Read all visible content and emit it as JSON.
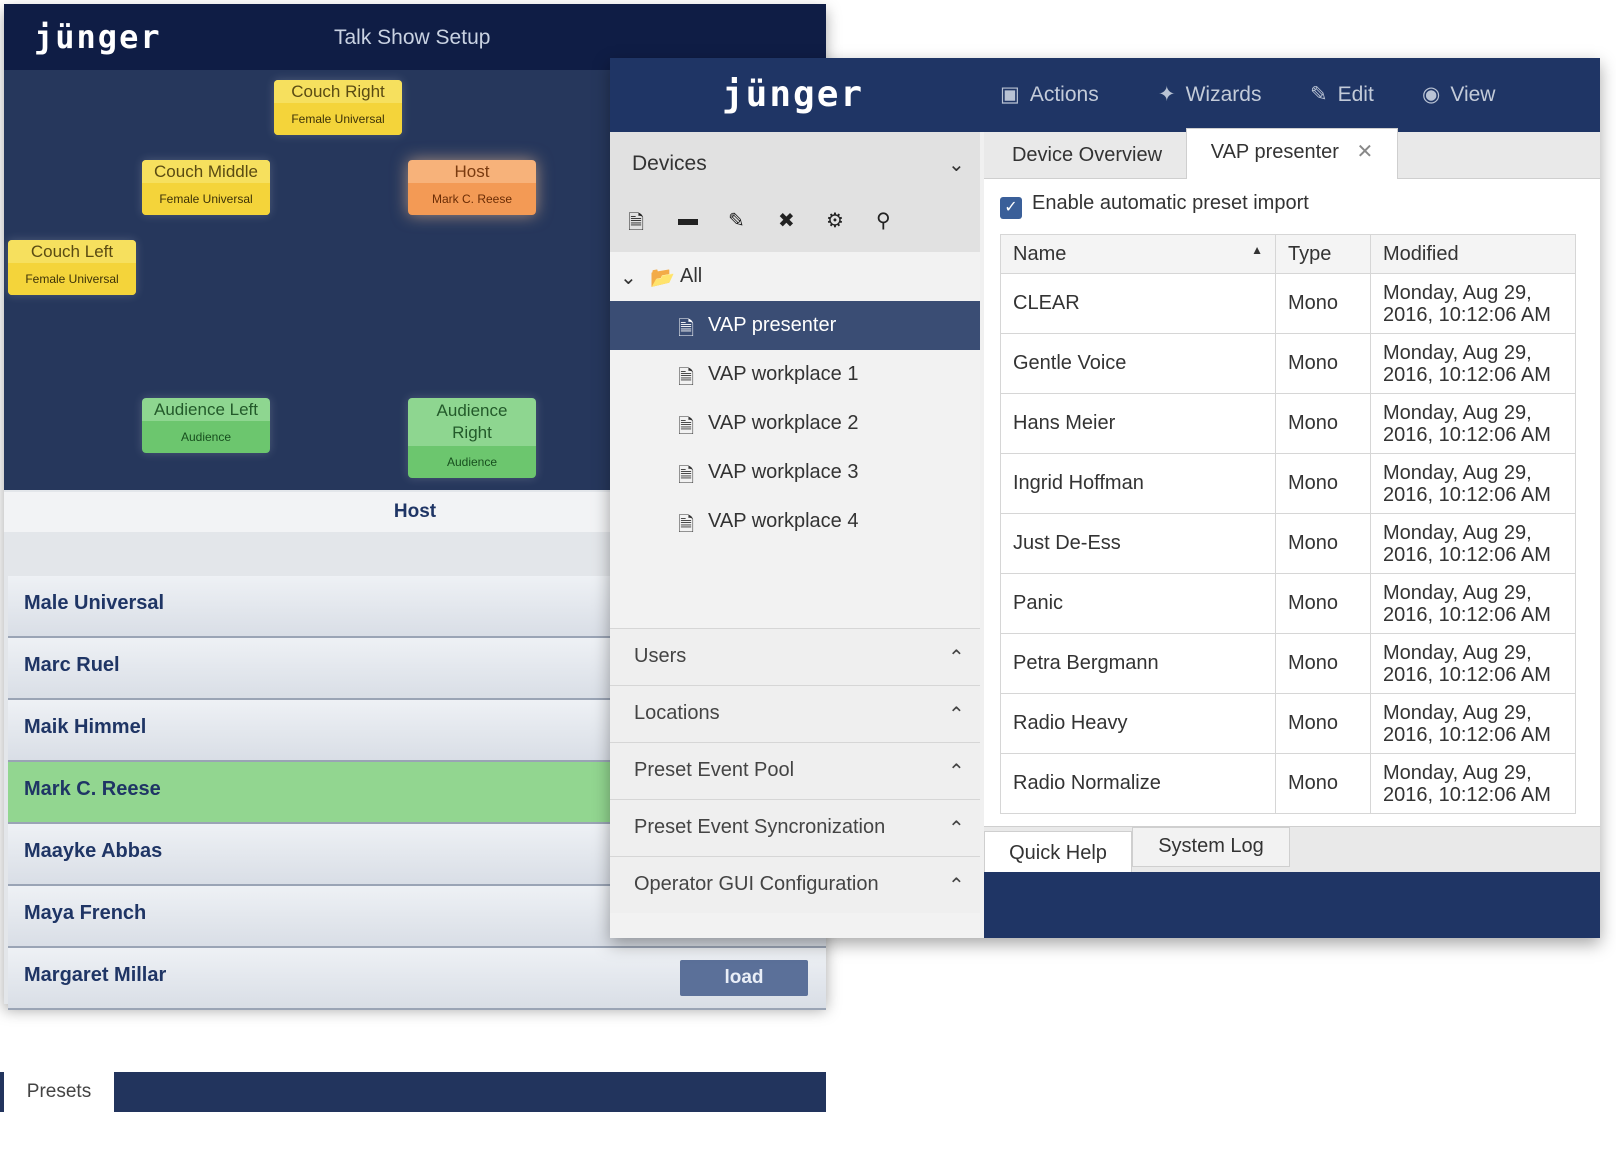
{
  "back_window": {
    "logo": "jünger",
    "title": "Talk Show Setup",
    "tiles": [
      {
        "title": "Couch Right",
        "subtitle": "Female Universal",
        "color": "yellow"
      },
      {
        "title": "Couch Middle",
        "subtitle": "Female Universal",
        "color": "yellow"
      },
      {
        "title": "Host",
        "subtitle": "Mark C. Reese",
        "color": "orange"
      },
      {
        "title": "Couch Left",
        "subtitle": "Female Universal",
        "color": "yellow"
      },
      {
        "title": "Audience Left",
        "subtitle": "Audience",
        "color": "green"
      },
      {
        "title": "Audience Right",
        "subtitle": "Audience",
        "color": "green"
      }
    ],
    "selected_label": "Host",
    "names": [
      "Male Universal",
      "Marc Ruel",
      "Maik Himmel",
      "Mark C. Reese",
      "Maayke Abbas",
      "Maya French",
      "Margaret Millar"
    ],
    "active_name": "Mark C. Reese",
    "load_label": "load",
    "presets_tab": "Presets"
  },
  "front_window": {
    "logo": "jünger",
    "menu": [
      {
        "icon": "briefcase-icon",
        "label": "Actions"
      },
      {
        "icon": "wand-icon",
        "label": "Wizards"
      },
      {
        "icon": "pencil-icon",
        "label": "Edit"
      },
      {
        "icon": "eye-icon",
        "label": "View"
      }
    ],
    "sidebar": {
      "devices_title": "Devices",
      "toolbar_icons": [
        "new-file-icon",
        "folder-icon",
        "edit-icon",
        "delete-icon",
        "settings-icon",
        "search-icon"
      ],
      "tree_root": "All",
      "devices": [
        "VAP presenter",
        "VAP workplace 1",
        "VAP workplace 2",
        "VAP workplace 3",
        "VAP workplace 4"
      ],
      "selected_device": "VAP presenter",
      "sections": [
        "Users",
        "Locations",
        "Preset Event Pool",
        "Preset Event Syncronization",
        "Operator GUI Configuration"
      ]
    },
    "tabs": [
      {
        "label": "Device Overview",
        "active": false
      },
      {
        "label": "VAP presenter",
        "active": true,
        "closable": true
      }
    ],
    "checkbox": {
      "label": "Enable automatic preset import",
      "checked": true
    },
    "table": {
      "columns": [
        "Name",
        "Type",
        "Modified"
      ],
      "sort": {
        "column": "Name",
        "direction": "ascending"
      },
      "rows": [
        {
          "name": "CLEAR",
          "type": "Mono",
          "modified_1": "Monday, Aug 29,",
          "modified_2": "2016, 10:12:06 AM"
        },
        {
          "name": "Gentle Voice",
          "type": "Mono",
          "modified_1": "Monday, Aug 29,",
          "modified_2": "2016, 10:12:06 AM"
        },
        {
          "name": "Hans Meier",
          "type": "Mono",
          "modified_1": "Monday, Aug 29,",
          "modified_2": "2016, 10:12:06 AM"
        },
        {
          "name": "Ingrid Hoffman",
          "type": "Mono",
          "modified_1": "Monday, Aug 29,",
          "modified_2": "2016, 10:12:06 AM"
        },
        {
          "name": "Just De-Ess",
          "type": "Mono",
          "modified_1": "Monday, Aug 29,",
          "modified_2": "2016, 10:12:06 AM"
        },
        {
          "name": "Panic",
          "type": "Mono",
          "modified_1": "Monday, Aug 29,",
          "modified_2": "2016, 10:12:06 AM"
        },
        {
          "name": "Petra Bergmann",
          "type": "Mono",
          "modified_1": "Monday, Aug 29,",
          "modified_2": "2016, 10:12:06 AM"
        },
        {
          "name": "Radio Heavy",
          "type": "Mono",
          "modified_1": "Monday, Aug 29,",
          "modified_2": "2016, 10:12:06 AM"
        },
        {
          "name": "Radio Normalize",
          "type": "Mono",
          "modified_1": "Monday, Aug 29,",
          "modified_2": "2016, 10:12:06 AM"
        }
      ]
    },
    "bottom_tabs": [
      "Quick Help",
      "System Log"
    ]
  },
  "colors": {
    "header_dark": "#0f1d45",
    "header_blue": "#1f3565",
    "selection": "#3a4d74",
    "active_row": "#92d690",
    "tile_yellow": "#f3d93d",
    "tile_orange": "#f39a55",
    "tile_green": "#6cc66e"
  }
}
